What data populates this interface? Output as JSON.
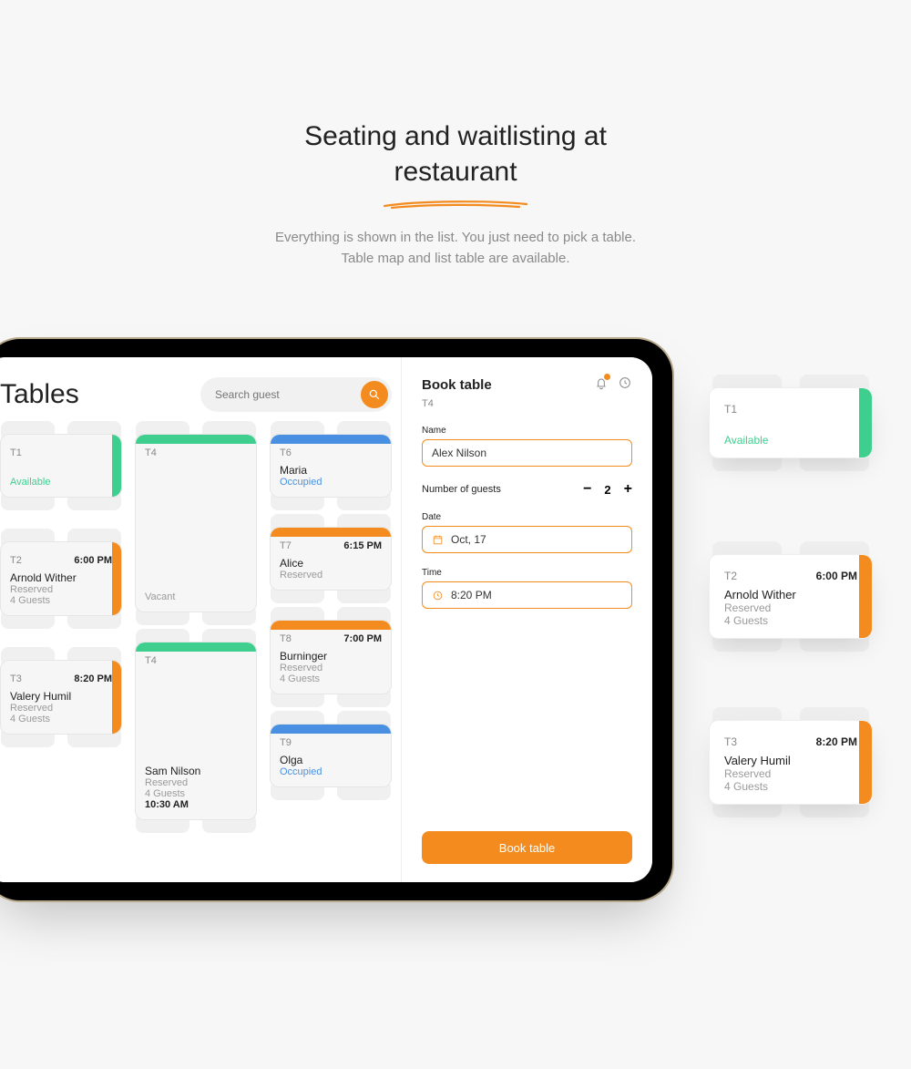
{
  "hero": {
    "title_l1": "Seating and waitlisting at",
    "title_l2": "restaurant",
    "sub_l1": "Everything is shown in the list. You just need to pick a table.",
    "sub_l2": "Table map and list table are available."
  },
  "left": {
    "title": "Tables",
    "search_ph": "Search guest"
  },
  "tables": {
    "t1": {
      "id": "T1",
      "status": "Available"
    },
    "t2": {
      "id": "T2",
      "time": "6:00 PM",
      "name": "Arnold Wither",
      "status": "Reserved",
      "guests": "4 Guests"
    },
    "t3": {
      "id": "T3",
      "time": "8:20 PM",
      "name": "Valery Humil",
      "status": "Reserved",
      "guests": "4 Guests"
    },
    "t4a": {
      "id": "T4",
      "status": "Vacant"
    },
    "t4b": {
      "id": "T4",
      "name": "Sam Nilson",
      "status": "Reserved",
      "guests": "4 Guests",
      "when": "10:30 AM"
    },
    "t6": {
      "id": "T6",
      "name": "Maria",
      "status": "Occupied"
    },
    "t7": {
      "id": "T7",
      "time": "6:15 PM",
      "name": "Alice",
      "status": "Reserved"
    },
    "t8": {
      "id": "T8",
      "time": "7:00 PM",
      "name": "Burninger",
      "status": "Reserved",
      "guests": "4 Guests"
    },
    "t9": {
      "id": "T9",
      "name": "Olga",
      "status": "Occupied"
    }
  },
  "book": {
    "title": "Book table",
    "sub": "T4",
    "name_label": "Name",
    "name_value": "Alex Nilson",
    "num_label": "Number of guests",
    "num_value": "2",
    "date_label": "Date",
    "date_value": "Oct, 17",
    "time_label": "Time",
    "time_value": "8:20 PM",
    "btn": "Book table"
  },
  "promo": {
    "p1": {
      "id": "T1",
      "status": "Available"
    },
    "p2": {
      "id": "T2",
      "time": "6:00 PM",
      "name": "Arnold Wither",
      "status": "Reserved",
      "guests": "4 Guests"
    },
    "p3": {
      "id": "T3",
      "time": "8:20 PM",
      "name": "Valery Humil",
      "status": "Reserved",
      "guests": "4 Guests"
    }
  }
}
